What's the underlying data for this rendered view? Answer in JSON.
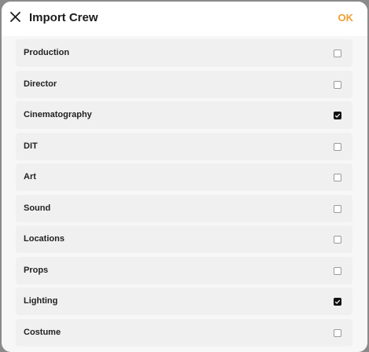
{
  "header": {
    "title": "Import Crew",
    "ok_label": "OK",
    "close_icon": "close-icon"
  },
  "colors": {
    "accent": "#f0a030",
    "row_background": "#f0f0f0",
    "sheet_background": "#f7f7f7",
    "checked": "#111111"
  },
  "departments": [
    {
      "label": "Production",
      "checked": false
    },
    {
      "label": "Director",
      "checked": false
    },
    {
      "label": "Cinematography",
      "checked": true
    },
    {
      "label": "DIT",
      "checked": false
    },
    {
      "label": "Art",
      "checked": false
    },
    {
      "label": "Sound",
      "checked": false
    },
    {
      "label": "Locations",
      "checked": false
    },
    {
      "label": "Props",
      "checked": false
    },
    {
      "label": "Lighting",
      "checked": true
    },
    {
      "label": "Costume",
      "checked": false
    }
  ]
}
